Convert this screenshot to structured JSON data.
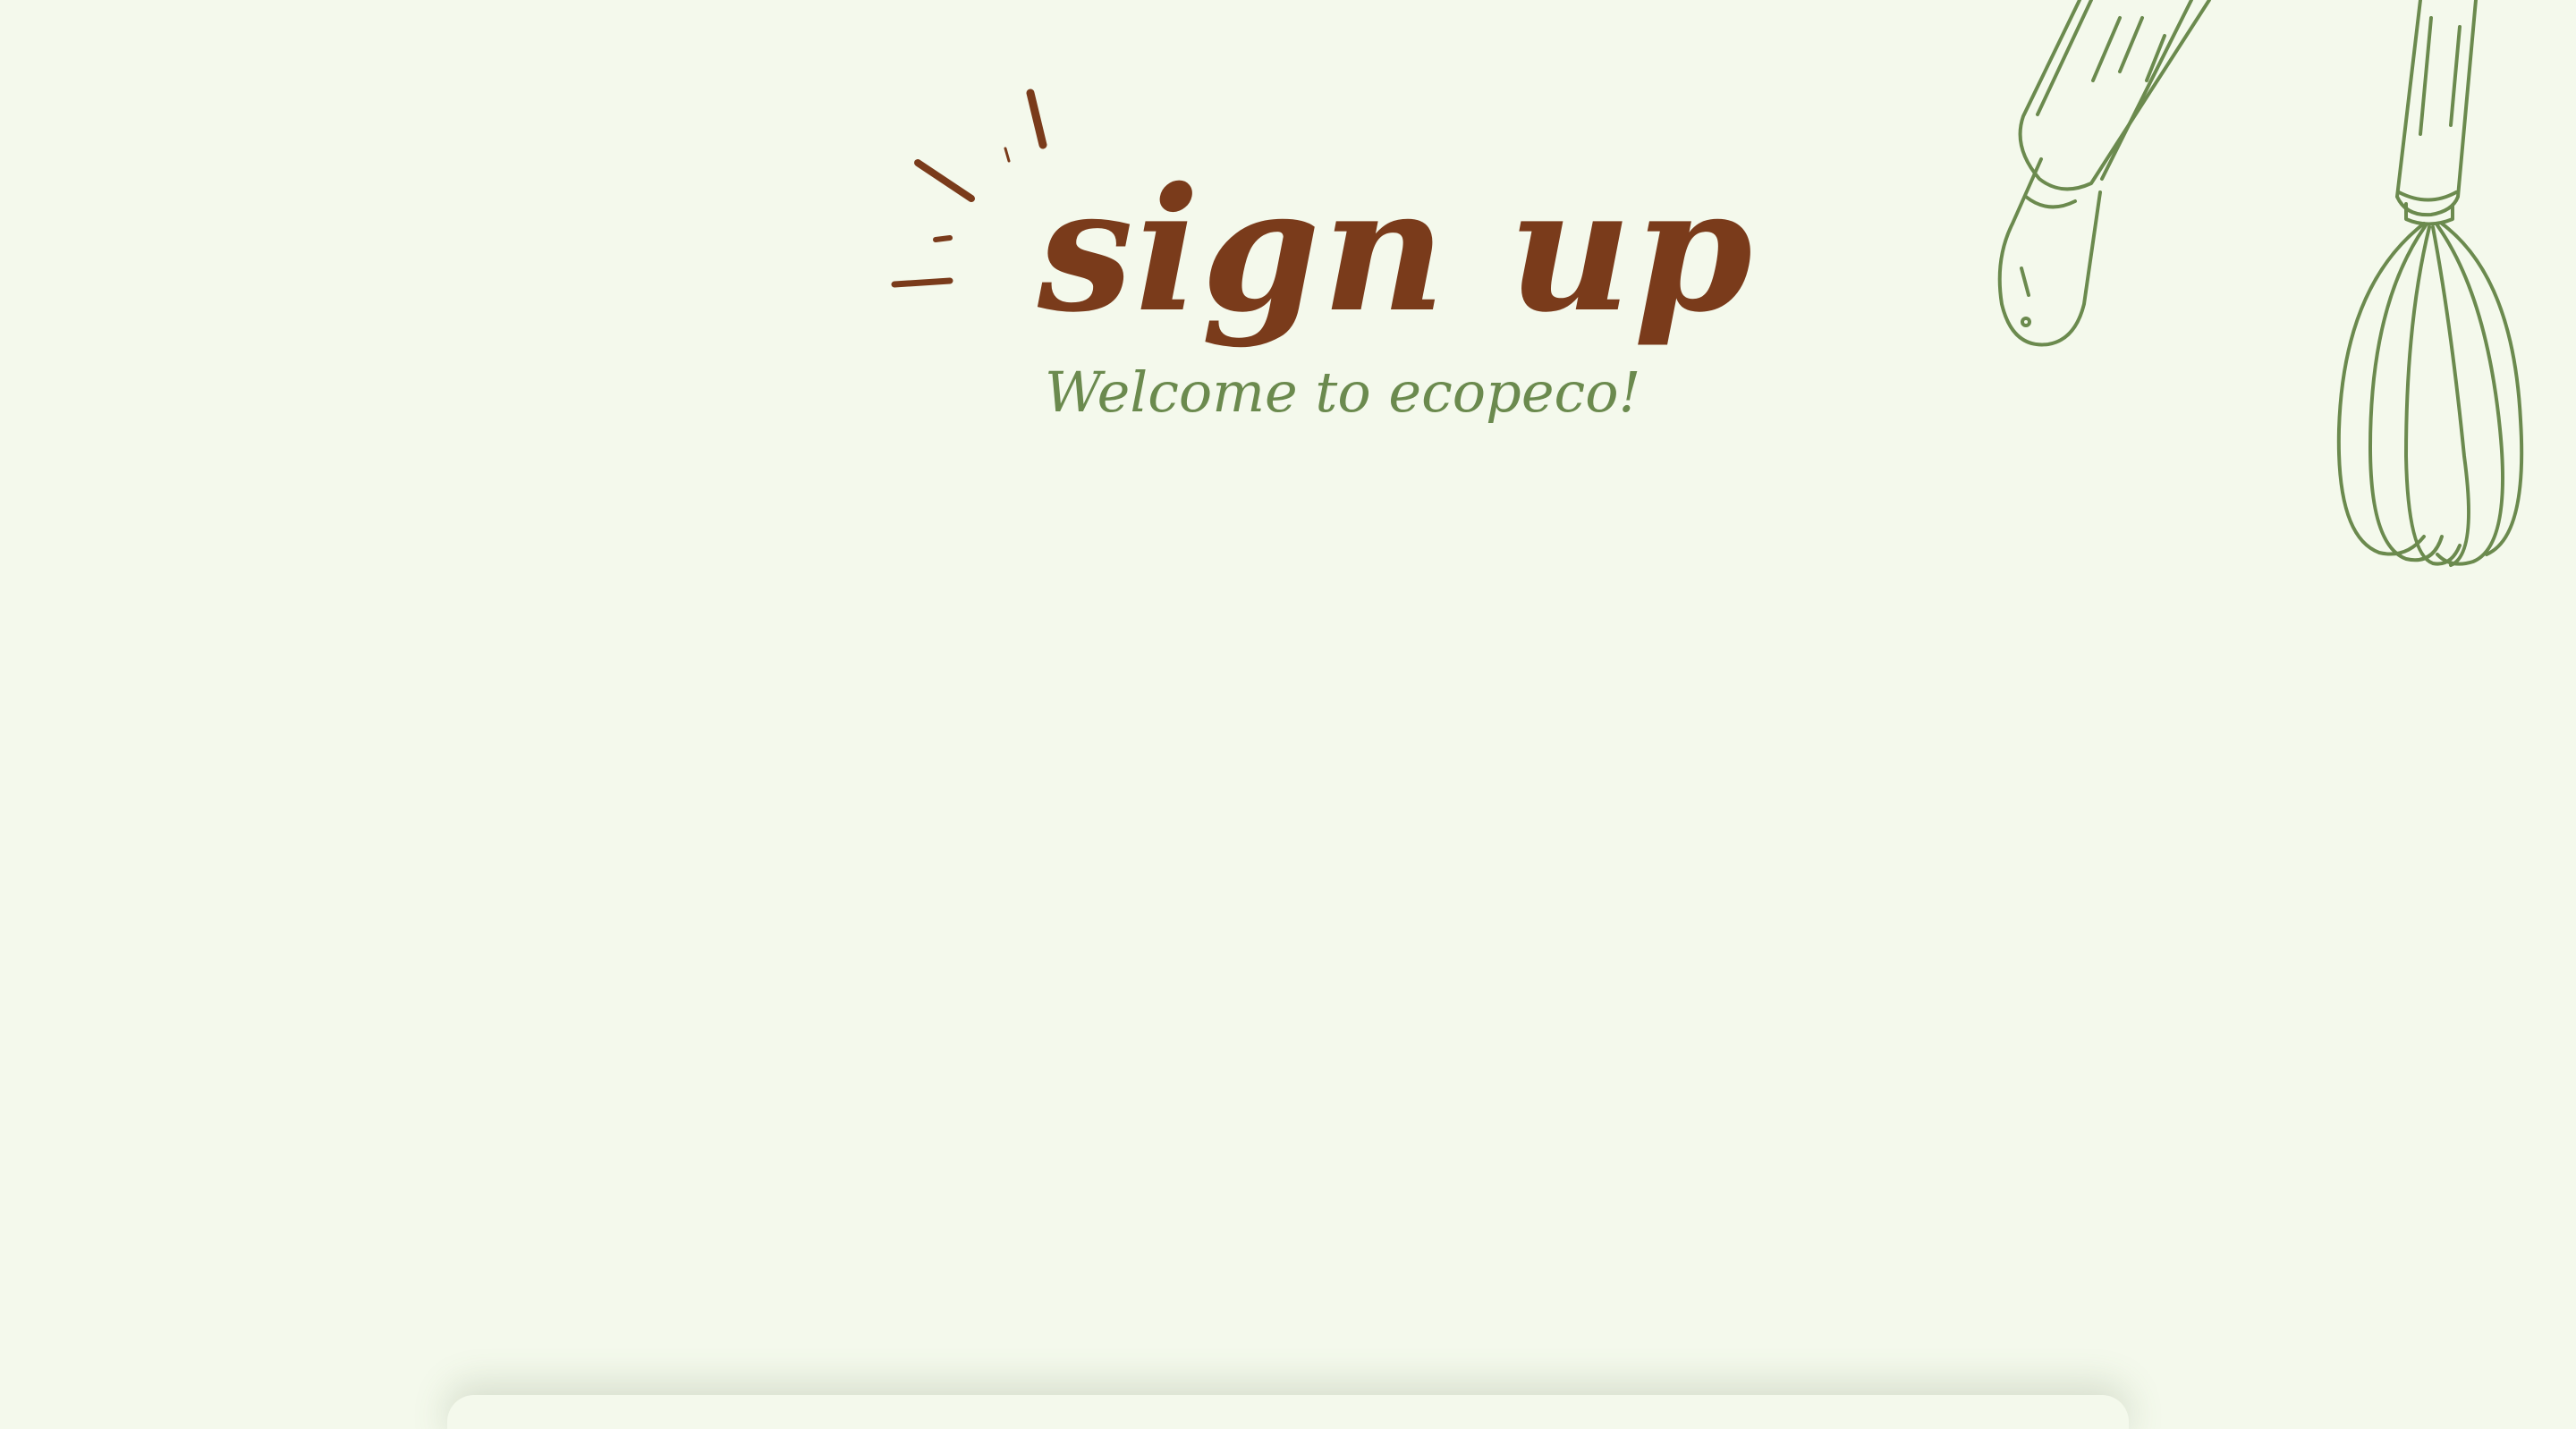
{
  "header": {
    "title": "sign up",
    "subtitle": "Welcome to ecopeco!"
  },
  "decor": {
    "sparkle_icon": "sparkle-lines-icon",
    "tools_icon": "rolling-pin-and-whisk-icon"
  },
  "colors": {
    "background": "#f4f9ec",
    "title": "#7a3b1b",
    "accent_green": "#6b8a4e"
  }
}
